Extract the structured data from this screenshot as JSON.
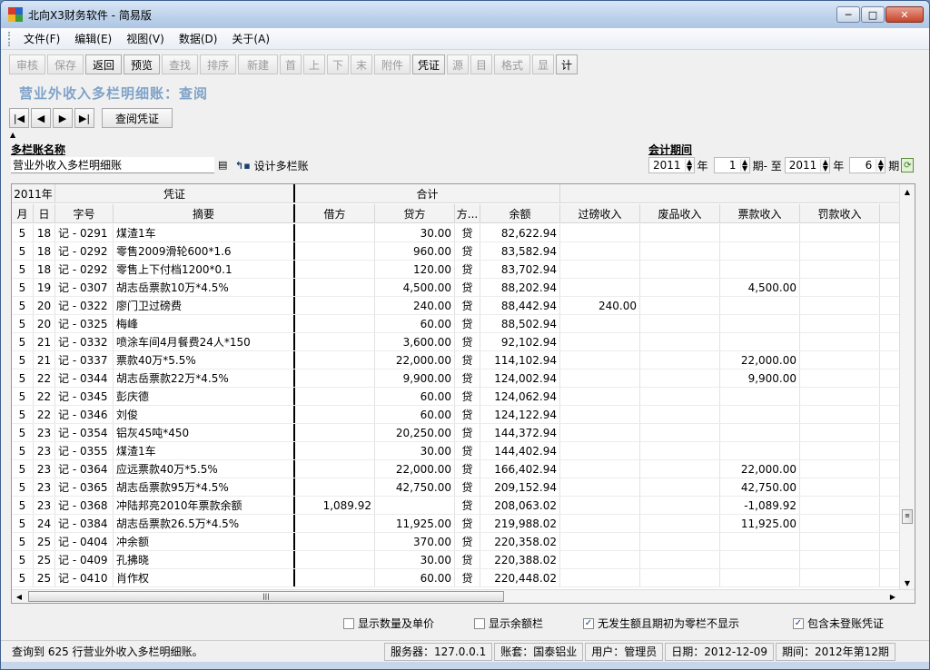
{
  "window": {
    "title": "北向X3财务软件 - 简易版",
    "min_label": "─",
    "max_label": "□",
    "close_label": "✕"
  },
  "menu": [
    "文件(F)",
    "编辑(E)",
    "视图(V)",
    "数据(D)",
    "关于(A)"
  ],
  "toolbar": [
    {
      "label": "审核",
      "enabled": false
    },
    {
      "label": "保存",
      "enabled": false
    },
    {
      "label": "返回",
      "enabled": true
    },
    {
      "label": "预览",
      "enabled": true
    },
    {
      "label": "查找",
      "enabled": false
    },
    {
      "label": "排序",
      "enabled": false
    },
    {
      "label": "新建",
      "enabled": false
    },
    {
      "label": "首",
      "enabled": false
    },
    {
      "label": "上",
      "enabled": false
    },
    {
      "label": "下",
      "enabled": false
    },
    {
      "label": "末",
      "enabled": false
    },
    {
      "label": "附件",
      "enabled": false
    },
    {
      "label": "凭证",
      "enabled": true
    },
    {
      "label": "源",
      "enabled": false
    },
    {
      "label": "目",
      "enabled": false
    },
    {
      "label": "格式",
      "enabled": false
    },
    {
      "label": "显",
      "enabled": false
    },
    {
      "label": "计",
      "enabled": true
    }
  ],
  "page_title": "营业外收入多栏明细账：查阅",
  "nav": {
    "view_voucher": "查阅凭证"
  },
  "form": {
    "ledger_name_label": "多栏账名称",
    "ledger_name_value": "营业外收入多栏明细账",
    "design_label": "设计多栏账",
    "period_label": "会计期间",
    "start_year": "2011",
    "year_unit": "年",
    "start_period": "1",
    "period_to": "期- 至",
    "end_year": "2011",
    "end_period": "6",
    "period_unit": "期"
  },
  "table": {
    "header_top": {
      "year": "2011年",
      "voucher": "凭证",
      "total": "合计"
    },
    "columns": [
      "月",
      "日",
      "字号",
      "摘要",
      "借方",
      "贷方",
      "方...",
      "余额",
      "过磅收入",
      "废品收入",
      "票款收入",
      "罚款收入"
    ],
    "rows": [
      [
        "5",
        "18",
        "记 - 0291",
        "煤渣1车",
        "",
        "30.00",
        "贷",
        "82,622.94",
        "",
        "",
        "",
        ""
      ],
      [
        "5",
        "18",
        "记 - 0292",
        "零售2009滑轮600*1.6",
        "",
        "960.00",
        "贷",
        "83,582.94",
        "",
        "",
        "",
        ""
      ],
      [
        "5",
        "18",
        "记 - 0292",
        "零售上下付档1200*0.1",
        "",
        "120.00",
        "贷",
        "83,702.94",
        "",
        "",
        "",
        ""
      ],
      [
        "5",
        "19",
        "记 - 0307",
        "胡志岳票款10万*4.5%",
        "",
        "4,500.00",
        "贷",
        "88,202.94",
        "",
        "",
        "4,500.00",
        ""
      ],
      [
        "5",
        "20",
        "记 - 0322",
        "廖门卫过磅费",
        "",
        "240.00",
        "贷",
        "88,442.94",
        "240.00",
        "",
        "",
        ""
      ],
      [
        "5",
        "20",
        "记 - 0325",
        "梅峰",
        "",
        "60.00",
        "贷",
        "88,502.94",
        "",
        "",
        "",
        ""
      ],
      [
        "5",
        "21",
        "记 - 0332",
        "喷涂车间4月餐费24人*150",
        "",
        "3,600.00",
        "贷",
        "92,102.94",
        "",
        "",
        "",
        ""
      ],
      [
        "5",
        "21",
        "记 - 0337",
        "票款40万*5.5%",
        "",
        "22,000.00",
        "贷",
        "114,102.94",
        "",
        "",
        "22,000.00",
        ""
      ],
      [
        "5",
        "22",
        "记 - 0344",
        "胡志岳票款22万*4.5%",
        "",
        "9,900.00",
        "贷",
        "124,002.94",
        "",
        "",
        "9,900.00",
        ""
      ],
      [
        "5",
        "22",
        "记 - 0345",
        "彭庆德",
        "",
        "60.00",
        "贷",
        "124,062.94",
        "",
        "",
        "",
        ""
      ],
      [
        "5",
        "22",
        "记 - 0346",
        "刘俊",
        "",
        "60.00",
        "贷",
        "124,122.94",
        "",
        "",
        "",
        ""
      ],
      [
        "5",
        "23",
        "记 - 0354",
        "铝灰45吨*450",
        "",
        "20,250.00",
        "贷",
        "144,372.94",
        "",
        "",
        "",
        ""
      ],
      [
        "5",
        "23",
        "记 - 0355",
        "煤渣1车",
        "",
        "30.00",
        "贷",
        "144,402.94",
        "",
        "",
        "",
        ""
      ],
      [
        "5",
        "23",
        "记 - 0364",
        "应远票款40万*5.5%",
        "",
        "22,000.00",
        "贷",
        "166,402.94",
        "",
        "",
        "22,000.00",
        ""
      ],
      [
        "5",
        "23",
        "记 - 0365",
        "胡志岳票款95万*4.5%",
        "",
        "42,750.00",
        "贷",
        "209,152.94",
        "",
        "",
        "42,750.00",
        ""
      ],
      [
        "5",
        "23",
        "记 - 0368",
        "冲陆邦亮2010年票款余额",
        "1,089.92",
        "",
        "贷",
        "208,063.02",
        "",
        "",
        "-1,089.92",
        ""
      ],
      [
        "5",
        "24",
        "记 - 0384",
        "胡志岳票款26.5万*4.5%",
        "",
        "11,925.00",
        "贷",
        "219,988.02",
        "",
        "",
        "11,925.00",
        ""
      ],
      [
        "5",
        "25",
        "记 - 0404",
        "冲余额",
        "",
        "370.00",
        "贷",
        "220,358.02",
        "",
        "",
        "",
        ""
      ],
      [
        "5",
        "25",
        "记 - 0409",
        "孔拂晓",
        "",
        "30.00",
        "贷",
        "220,388.02",
        "",
        "",
        "",
        ""
      ],
      [
        "5",
        "25",
        "记 - 0410",
        "肖作权",
        "",
        "60.00",
        "贷",
        "220,448.02",
        "",
        "",
        "",
        ""
      ]
    ]
  },
  "options": {
    "show_qty": {
      "label": "显示数量及单价",
      "checked": false
    },
    "show_balance": {
      "label": "显示余额栏",
      "checked": false
    },
    "hide_zero": {
      "label": "无发生额且期初为零栏不显示",
      "checked": true
    },
    "include_unposted": {
      "label": "包含未登账凭证",
      "checked": true
    }
  },
  "status": {
    "message": "查询到 625 行营业外收入多栏明细账。",
    "server": "服务器：127.0.0.1",
    "account": "账套：国泰铝业",
    "user": "用户：管理员",
    "date": "日期：2012-12-09",
    "period": "期间：2012年第12期"
  }
}
